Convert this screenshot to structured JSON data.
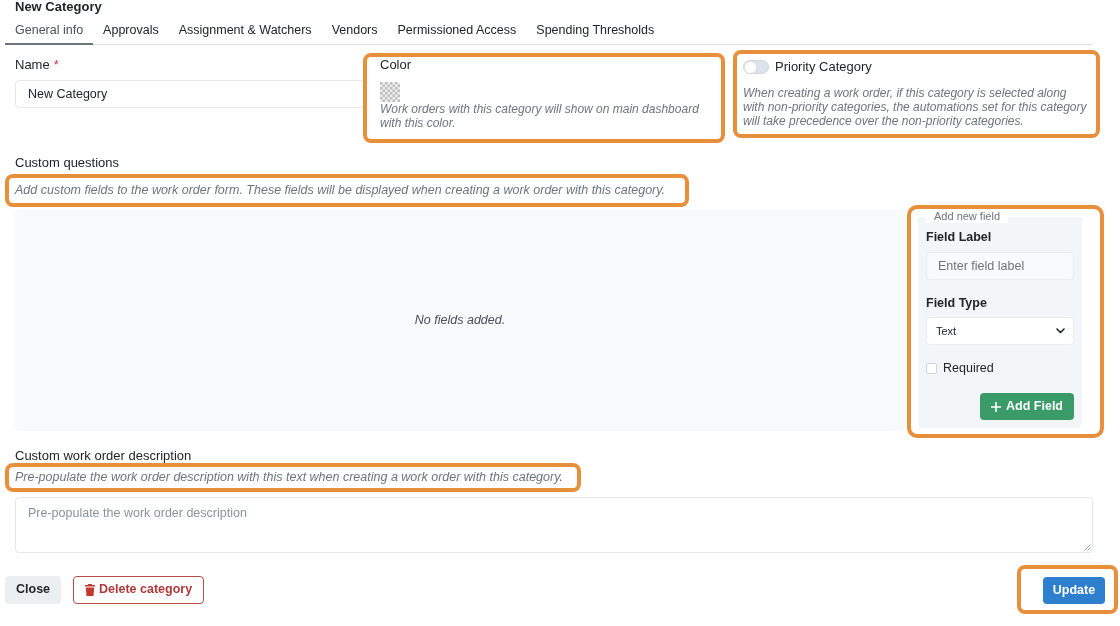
{
  "dialog": {
    "title": "New Category"
  },
  "tabs": [
    {
      "label": "General info",
      "selected": true
    },
    {
      "label": "Approvals",
      "selected": false
    },
    {
      "label": "Assignment & Watchers",
      "selected": false
    },
    {
      "label": "Vendors",
      "selected": false
    },
    {
      "label": "Permissioned Access",
      "selected": false
    },
    {
      "label": "Spending Thresholds",
      "selected": false
    }
  ],
  "name_field": {
    "label": "Name",
    "required_mark": "*",
    "value": "New Category"
  },
  "color_field": {
    "label": "Color",
    "hint": "Work orders with this category will show on main dashboard with this color.",
    "highlighted": true
  },
  "priority": {
    "label": "Priority Category",
    "on": false,
    "hint": "When creating a work order, if this category is selected along with non-priority categories, the automations set for this category will take precedence over the non-priority categories.",
    "highlighted": true
  },
  "custom_questions": {
    "label": "Custom questions",
    "hint": "Add custom fields to the work order form. These fields will be displayed when creating a work order with this category.",
    "hint_highlighted": true,
    "empty_text": "No fields added.",
    "add_field_panel": {
      "legend": "Add new field",
      "highlighted": true,
      "field_label": {
        "label": "Field Label",
        "placeholder": "Enter field label"
      },
      "field_type": {
        "label": "Field Type",
        "value": "Text"
      },
      "required": {
        "label": "Required",
        "checked": false
      },
      "button": "Add Field"
    }
  },
  "description": {
    "label": "Custom work order description",
    "hint": "Pre-populate the work order description with this text when creating a work order with this category.",
    "hint_highlighted": true,
    "placeholder": "Pre-populate the work order description"
  },
  "footer": {
    "buttons": [
      {
        "label": "Close",
        "kind": "secondary",
        "highlighted": false
      },
      {
        "label": "Delete category",
        "kind": "danger",
        "highlighted": false
      },
      {
        "label": "Update",
        "kind": "primary",
        "highlighted": true
      }
    ]
  }
}
